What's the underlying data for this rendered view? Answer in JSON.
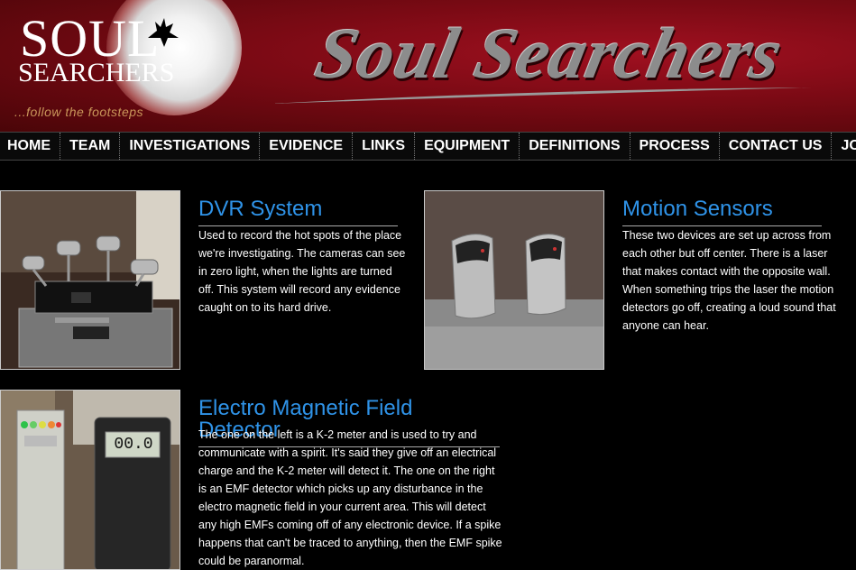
{
  "header": {
    "logo_line1": "SOUL",
    "logo_line2": "SEARCHERS",
    "tagline": "...follow the footsteps",
    "banner_title": "Soul Searchers"
  },
  "nav": {
    "items": [
      "HOME",
      "TEAM",
      "INVESTIGATIONS",
      "EVIDENCE",
      "LINKS",
      "EQUIPMENT",
      "DEFINITIONS",
      "PROCESS",
      "CONTACT US",
      "JOIN"
    ]
  },
  "sections": [
    {
      "title": "DVR System",
      "text": "Used to record the hot spots of the place we're investigating. The cameras can see in zero light, when the lights are turned off. This system will record any evidence caught on to its hard drive."
    },
    {
      "title": "Motion Sensors",
      "text": "These two devices are set up across from each other but off center. There is a laser that makes contact with the opposite wall. When something trips the laser the motion detectors go off, creating a loud sound that anyone can hear."
    },
    {
      "title": "Electro Magnetic Field Detector",
      "text": "The one on the left is a K-2 meter and is used to try and communicate with a spirit. It's said they give off an electrical charge and the K-2 meter will detect it. The one on the right is an EMF detector which picks up any disturbance in the electro magnetic field in your current area. This will detect any high EMFs coming off of any electronic device. If a spike happens that can't be traced to anything, then the EMF spike could be paranormal."
    }
  ],
  "emf_display": "00.0",
  "colors": {
    "header_red": "#7a0a14",
    "title_blue": "#2f93e8",
    "tagline_gold": "#c9965a"
  }
}
